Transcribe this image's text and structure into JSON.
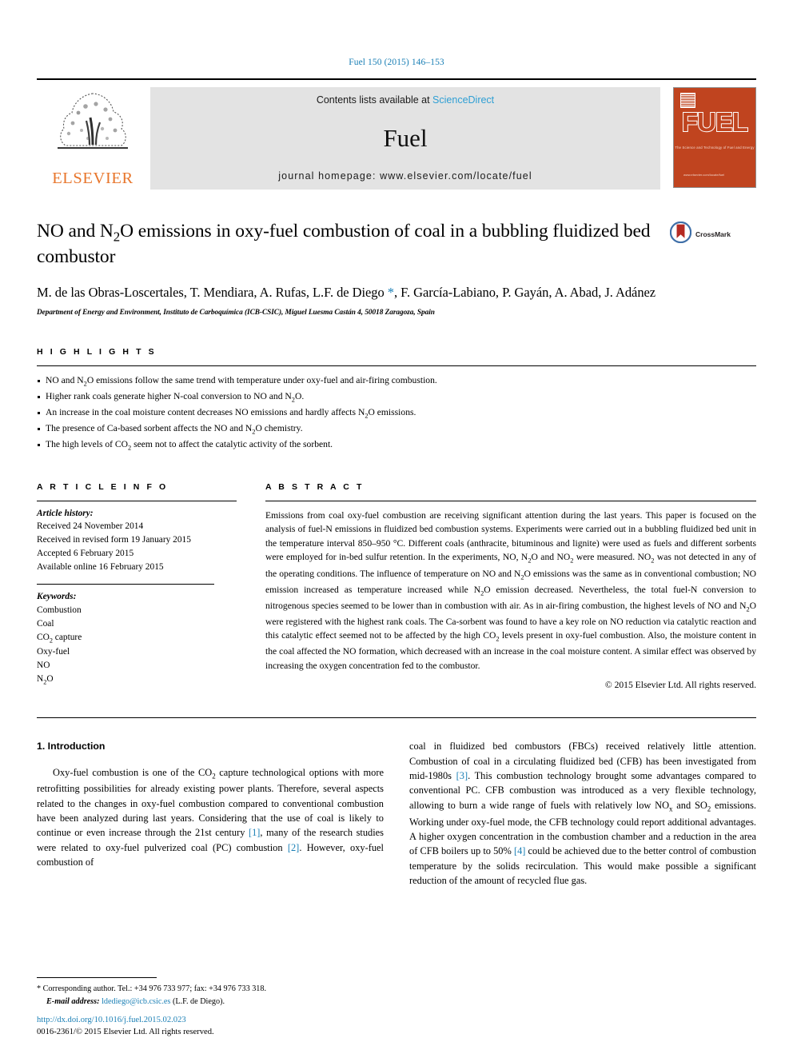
{
  "running_head": "Fuel 150 (2015) 146–153",
  "masthead": {
    "publisher": "ELSEVIER",
    "contents_prefix": "Contents lists available at ",
    "sciencedirect": "ScienceDirect",
    "journal_title": "Fuel",
    "homepage": "journal homepage: www.elsevier.com/locate/fuel",
    "cover_title": "FUEL",
    "cover_subtitle": "The Science and Technology of Fuel and Energy",
    "cover_footer": "www.elsevier.com/locate/fuel",
    "colors": {
      "link": "#2e9fd4",
      "elsevier_orange": "#e8762c",
      "cover_orange": "#c0441f",
      "banner_grey": "#e3e3e3"
    }
  },
  "article": {
    "title": "NO and N₂O emissions in oxy-fuel combustion of coal in a bubbling fluidized bed combustor",
    "authors": "M. de las Obras-Loscertales, T. Mendiara, A. Rufas, L.F. de Diego *, F. García-Labiano, P. Gayán, A. Abad, J. Adánez",
    "affiliation": "Department of Energy and Environment, Instituto de Carboquímica (ICB-CSIC), Miguel Luesma Castán 4, 50018 Zaragoza, Spain",
    "crossmark_label": "CrossMark"
  },
  "highlights": {
    "heading": "H I G H L I G H T S",
    "items": [
      "NO and N₂O emissions follow the same trend with temperature under oxy-fuel and air-firing combustion.",
      "Higher rank coals generate higher N-coal conversion to NO and N₂O.",
      "An increase in the coal moisture content decreases NO emissions and hardly affects N₂O emissions.",
      "The presence of Ca-based sorbent affects the NO and N₂O chemistry.",
      "The high levels of CO₂ seem not to affect the catalytic activity of the sorbent."
    ]
  },
  "article_info": {
    "heading": "A R T I C L E    I N F O",
    "history_label": "Article history:",
    "history": [
      "Received 24 November 2014",
      "Received in revised form 19 January 2015",
      "Accepted 6 February 2015",
      "Available online 16 February 2015"
    ],
    "keywords_label": "Keywords:",
    "keywords": [
      "Combustion",
      "Coal",
      "CO₂ capture",
      "Oxy-fuel",
      "NO",
      "N₂O"
    ]
  },
  "abstract": {
    "heading": "A B S T R A C T",
    "body": "Emissions from coal oxy-fuel combustion are receiving significant attention during the last years. This paper is focused on the analysis of fuel-N emissions in fluidized bed combustion systems. Experiments were carried out in a bubbling fluidized bed unit in the temperature interval 850–950 °C. Different coals (anthracite, bituminous and lignite) were used as fuels and different sorbents were employed for in-bed sulfur retention. In the experiments, NO, N₂O and NO₂ were measured. NO₂ was not detected in any of the operating conditions. The influence of temperature on NO and N₂O emissions was the same as in conventional combustion; NO emission increased as temperature increased while N₂O emission decreased. Nevertheless, the total fuel-N conversion to nitrogenous species seemed to be lower than in combustion with air. As in air-firing combustion, the highest levels of NO and N₂O were registered with the highest rank coals. The Ca-sorbent was found to have a key role on NO reduction via catalytic reaction and this catalytic effect seemed not to be affected by the high CO₂ levels present in oxy-fuel combustion. Also, the moisture content in the coal affected the NO formation, which decreased with an increase in the coal moisture content. A similar effect was observed by increasing the oxygen concentration fed to the combustor.",
    "copyright": "© 2015 Elsevier Ltd. All rights reserved."
  },
  "introduction": {
    "heading": "1. Introduction",
    "column_left": "Oxy-fuel combustion is one of the CO₂ capture technological options with more retrofitting possibilities for already existing power plants. Therefore, several aspects related to the changes in oxy-fuel combustion compared to conventional combustion have been analyzed during last years. Considering that the use of coal is likely to continue or even increase through the 21st century [1], many of the research studies were related to oxy-fuel pulverized coal (PC) combustion [2]. However, oxy-fuel combustion of",
    "column_right": "coal in fluidized bed combustors (FBCs) received relatively little attention. Combustion of coal in a circulating fluidized bed (CFB) has been investigated from mid-1980s [3]. This combustion technology brought some advantages compared to conventional PC. CFB combustion was introduced as a very flexible technology, allowing to burn a wide range of fuels with relatively low NOx and SO₂ emissions. Working under oxy-fuel mode, the CFB technology could report additional advantages. A higher oxygen concentration in the combustion chamber and a reduction in the area of CFB boilers up to 50% [4] could be achieved due to the better control of combustion temperature by the solids recirculation. This would make possible a significant reduction of the amount of recycled flue gas."
  },
  "footnote": {
    "corresponding": "* Corresponding author. Tel.: +34 976 733 977; fax: +34 976 733 318.",
    "email_label": "E-mail address:",
    "email": "ldediego@icb.csic.es",
    "email_owner": "(L.F. de Diego)."
  },
  "footer": {
    "doi": "http://dx.doi.org/10.1016/j.fuel.2015.02.023",
    "issn_line": "0016-2361/© 2015 Elsevier Ltd. All rights reserved."
  }
}
